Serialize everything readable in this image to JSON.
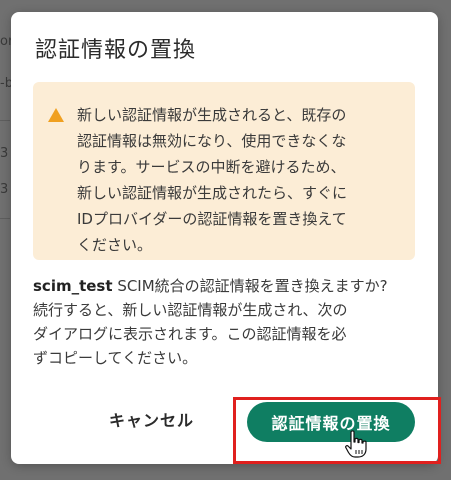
{
  "background": {
    "fragments": [
      "or",
      "-b",
      "3",
      "3"
    ]
  },
  "dialog": {
    "title": "認証情報の置換",
    "alert": {
      "icon": "warning-triangle-icon",
      "color": "#f0a020",
      "background": "#fcedd6",
      "lines": [
        "新しい認証情報が生成されると、既存の",
        "認証情報は無効になり、使用できなくな",
        "ります。サービスの中断を避けるため、",
        "新しい認証情報が生成されたら、すぐに",
        "IDプロバイダーの認証情報を置き換えて",
        "ください。"
      ]
    },
    "body": {
      "name": "scim_test",
      "lines": [
        " SCIM統合の認証情報を置き換えますか?",
        "続行すると、新しい認証情報が生成され、次の",
        "ダイアログに表示されます。この認証情報を必",
        "ずコピーしてください。"
      ]
    },
    "buttons": {
      "cancel_label": "キャンセル",
      "replace_label": "認証情報の置換",
      "replace_color": "#0f7e62"
    },
    "highlight_color": "#e0201e"
  }
}
